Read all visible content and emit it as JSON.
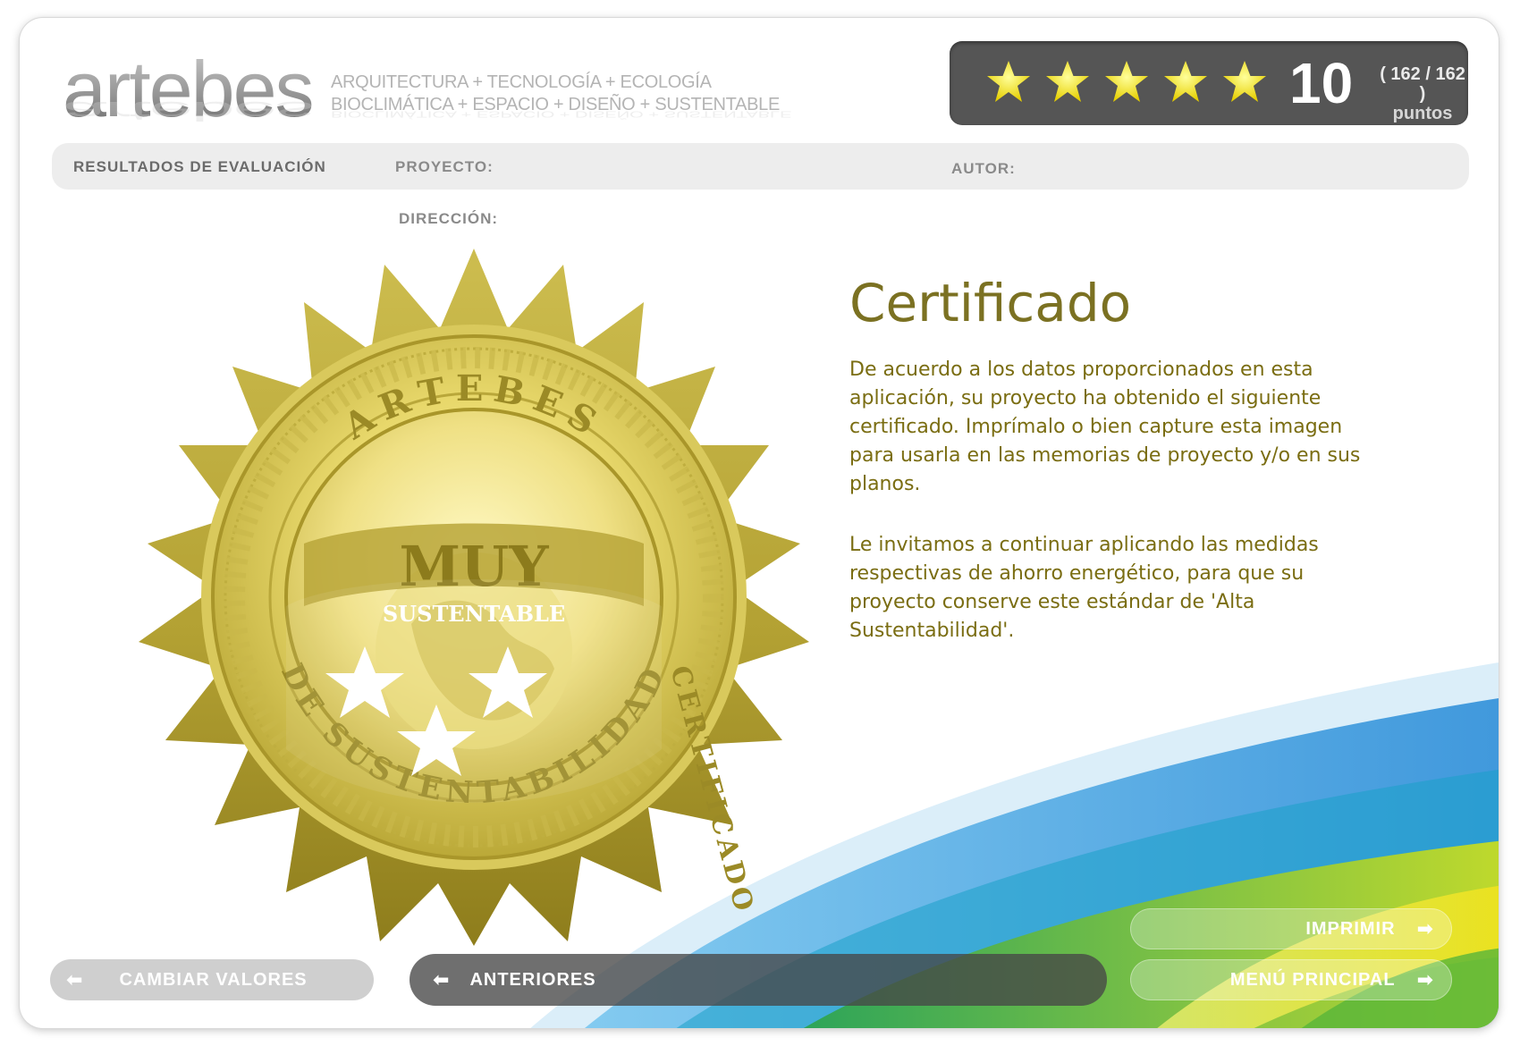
{
  "header": {
    "logo": "artebes",
    "tagline_1": "ARQUITECTURA + TECNOLOGÍA + ECOLOGÍA",
    "tagline_2": "BIOCLIMÁTICA + ESPACIO + DISEÑO + SUSTENTABLE"
  },
  "score": {
    "stars": 5,
    "value": "10",
    "points_detail": "( 162 / 162 )",
    "points_label": "puntos"
  },
  "info": {
    "section": "RESULTADOS DE EVALUACIÓN",
    "project_label": "PROYECTO:",
    "author_label": "AUTOR:",
    "address_label": "DIRECCIÓN:"
  },
  "seal": {
    "arc_top": "ARTEBES",
    "arc_right": "CERTIFICADO",
    "arc_bottom": "DE SUSTENTABILIDAD",
    "level": "MUY",
    "sublevel": "SUSTENTABLE",
    "stars": 3
  },
  "certificate": {
    "title": "Certificado",
    "paragraph_1": "De acuerdo a los datos proporcionados en esta aplicación, su proyecto ha obtenido el siguiente certificado. Imprímalo o bien capture esta imagen para usarla en las memorias de proyecto y/o en sus planos.",
    "paragraph_2": "Le invitamos a continuar aplicando las medidas respectivas de ahorro energético, para que su proyecto conserve este estándar de 'Alta Sustentabilidad'."
  },
  "buttons": {
    "change_values": "CAMBIAR VALORES",
    "previous": "ANTERIORES",
    "print": "IMPRIMIR",
    "main_menu": "MENÚ PRINCIPAL"
  },
  "colors": {
    "gold": "#c9b84a",
    "text_olive": "#7a6d12",
    "score_bg": "#555555",
    "star_yellow": "#f5e600"
  }
}
